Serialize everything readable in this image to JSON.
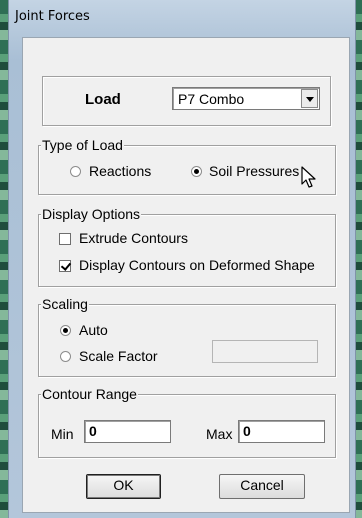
{
  "window": {
    "title": "Joint Forces"
  },
  "load": {
    "label": "Load",
    "selected": "P7 Combo"
  },
  "type_of_load": {
    "legend": "Type of Load",
    "options": [
      {
        "label": "Reactions",
        "selected": false
      },
      {
        "label": "Soil Pressures",
        "selected": true
      }
    ]
  },
  "display_options": {
    "legend": "Display Options",
    "items": [
      {
        "label": "Extrude Contours",
        "checked": false
      },
      {
        "label": "Display Contours on Deformed Shape",
        "checked": true
      }
    ]
  },
  "scaling": {
    "legend": "Scaling",
    "options": [
      {
        "label": "Auto",
        "selected": true
      },
      {
        "label": "Scale Factor",
        "selected": false
      }
    ],
    "scale_factor_value": ""
  },
  "contour_range": {
    "legend": "Contour Range",
    "min_label": "Min",
    "min_value": "0",
    "max_label": "Max",
    "max_value": "0"
  },
  "buttons": {
    "ok": "OK",
    "cancel": "Cancel"
  },
  "colors": {
    "dialog_face": "#f0f0f0",
    "titlebar": "#b6c9dc"
  }
}
